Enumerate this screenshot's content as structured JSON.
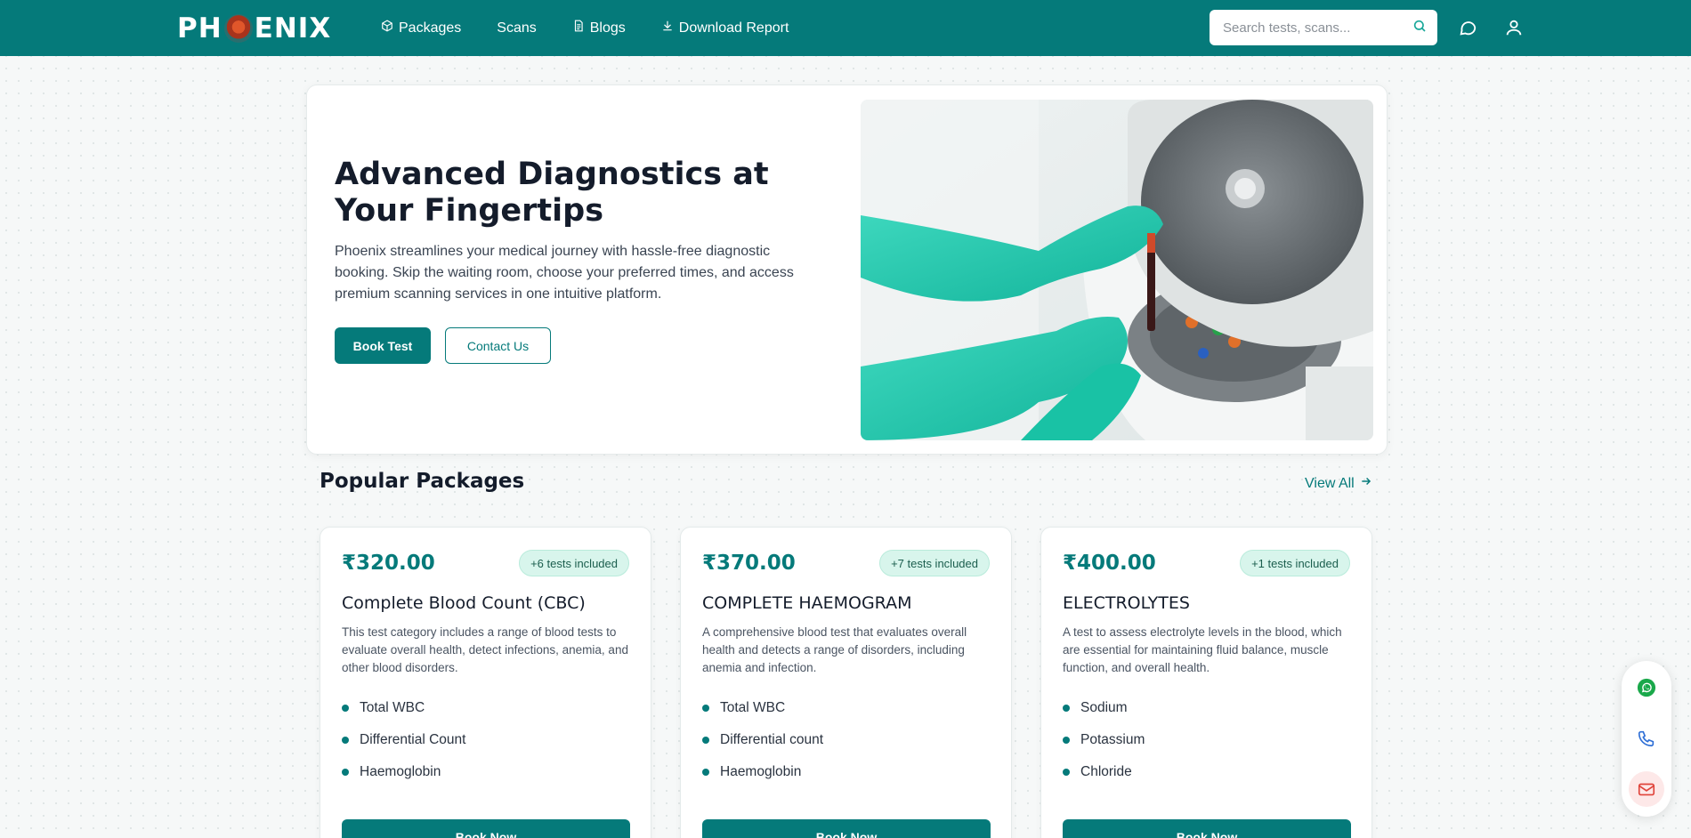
{
  "brand": {
    "logo_left": "PH",
    "logo_right": "ENIX"
  },
  "nav": {
    "links": [
      {
        "label": "Packages",
        "icon": "package-icon"
      },
      {
        "label": "Scans",
        "icon": ""
      },
      {
        "label": "Blogs",
        "icon": "document-icon"
      },
      {
        "label": "Download Report",
        "icon": "download-icon"
      }
    ],
    "search_placeholder": "Search tests, scans..."
  },
  "hero": {
    "title": "Advanced Diagnostics at Your Fingertips",
    "description": "Phoenix streamlines your medical journey with hassle-free diagnostic booking. Skip the waiting room, choose your preferred times, and access premium scanning services in one intuitive platform.",
    "primary_button": "Book Test",
    "secondary_button": "Contact Us"
  },
  "packages": {
    "title": "Popular Packages",
    "view_all": "View All",
    "items": [
      {
        "price": "₹320.00",
        "badge": "+6 tests included",
        "name": "Complete Blood Count (CBC)",
        "description": "This test category includes a range of blood tests to evaluate overall health, detect infections, anemia, and other blood disorders.",
        "tests": [
          "Total WBC",
          "Differential Count",
          "Haemoglobin"
        ],
        "button": "Book Now"
      },
      {
        "price": "₹370.00",
        "badge": "+7 tests included",
        "name": "COMPLETE HAEMOGRAM",
        "description": "A comprehensive blood test that evaluates overall health and detects a range of disorders, including anemia and infection.",
        "tests": [
          "Total WBC",
          "Differential count",
          "Haemoglobin"
        ],
        "button": "Book Now"
      },
      {
        "price": "₹400.00",
        "badge": "+1 tests included",
        "name": "ELECTROLYTES",
        "description": "A test to assess electrolyte levels in the blood, which are essential for maintaining fluid balance, muscle function, and overall health.",
        "tests": [
          "Sodium",
          "Potassium",
          "Chloride"
        ],
        "button": "Book Now"
      }
    ]
  },
  "colors": {
    "primary": "#057a7a",
    "badge_bg": "#d8f5ec",
    "whatsapp": "#1aa84a"
  }
}
